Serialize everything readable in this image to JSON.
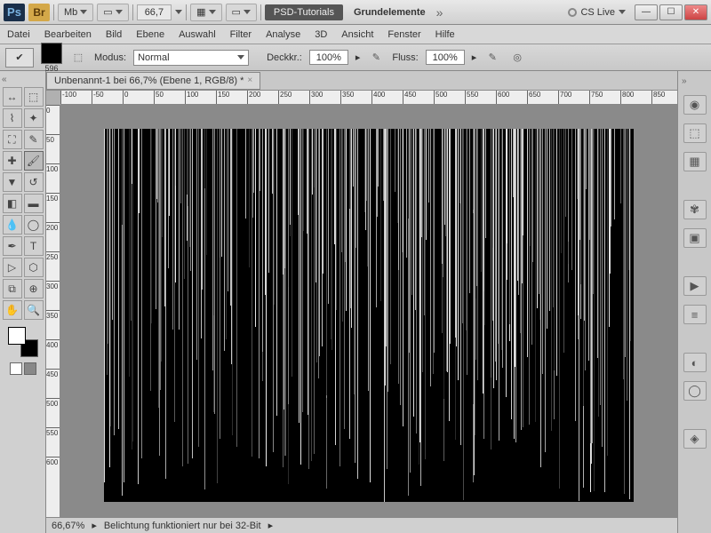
{
  "title": {
    "zoom": "66,7",
    "psd": "PSD-Tutorials",
    "grund": "Grundelemente",
    "cslive": "CS Live"
  },
  "menu": [
    "Datei",
    "Bearbeiten",
    "Bild",
    "Ebene",
    "Auswahl",
    "Filter",
    "Analyse",
    "3D",
    "Ansicht",
    "Fenster",
    "Hilfe"
  ],
  "opt": {
    "size": "596",
    "modus_lbl": "Modus:",
    "modus": "Normal",
    "deck_lbl": "Deckkr.:",
    "deck": "100%",
    "fluss_lbl": "Fluss:",
    "fluss": "100%"
  },
  "doc": {
    "tab": "Unbenannt-1 bei 66,7% (Ebene 1, RGB/8) *"
  },
  "ruler_h": [
    -100,
    -50,
    0,
    50,
    100,
    150,
    200,
    250,
    300,
    350,
    400,
    450,
    500,
    550,
    600,
    650,
    700,
    750,
    800,
    850
  ],
  "ruler_v": [
    0,
    50,
    100,
    150,
    200,
    250,
    300,
    350,
    400,
    450,
    500,
    550,
    600
  ],
  "status": {
    "zoom": "66,67%",
    "msg": "Belichtung funktioniert nur bei 32-Bit"
  }
}
